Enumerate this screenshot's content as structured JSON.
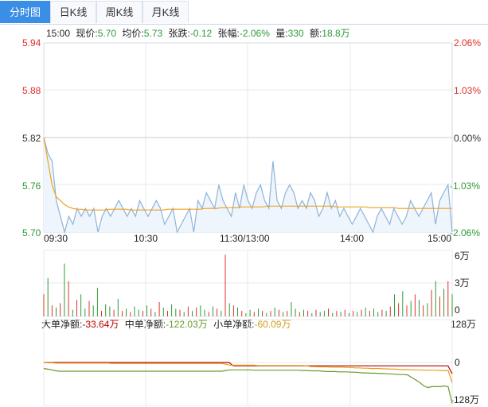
{
  "tabs": [
    {
      "label": "分时图",
      "active": true
    },
    {
      "label": "日K线",
      "active": false
    },
    {
      "label": "周K线",
      "active": false
    },
    {
      "label": "月K线",
      "active": false
    }
  ],
  "info": {
    "time": "15:00",
    "price_label": "现价:",
    "price": "5.70",
    "avg_label": "均价:",
    "avg": "5.73",
    "chg_label": "张跌:",
    "chg": "-0.12",
    "pct_label": "张幅:",
    "pct": "-2.06%",
    "vol_label": "量:",
    "vol": "330",
    "amt_label": "额:",
    "amt": "18.8万"
  },
  "flow": {
    "big_label": "大单净额:",
    "big": "-33.64万",
    "mid_label": "中单净额:",
    "mid": "-122.03万",
    "small_label": "小单净额:",
    "small": "-60.09万"
  },
  "colors": {
    "up": "#e0302c",
    "down": "#2e9a36",
    "price": "#8fb4d9",
    "avg": "#f0a020",
    "big": "#c00000",
    "mid": "#d2a01e",
    "small": "#6a9a2a"
  },
  "chart_data": [
    {
      "type": "line",
      "price_ticks": [
        "5.94",
        "5.88",
        "5.82",
        "5.76",
        "5.70"
      ],
      "pct_ticks": [
        "2.06%",
        "1.03%",
        "0.00%",
        "-1.03%",
        "-2.06%"
      ],
      "time_ticks": [
        "09:30",
        "10:30",
        "11:30/13:00",
        "14:00",
        "15:00"
      ],
      "ylim": [
        5.7,
        5.94
      ],
      "prev_close": 5.82,
      "series": [
        {
          "values": [
            5.82,
            5.8,
            5.79,
            5.74,
            5.72,
            5.7,
            5.72,
            5.71,
            5.73,
            5.72,
            5.73,
            5.72,
            5.73,
            5.7,
            5.72,
            5.73,
            5.72,
            5.73,
            5.74,
            5.73,
            5.72,
            5.73,
            5.72,
            5.74,
            5.73,
            5.72,
            5.73,
            5.74,
            5.73,
            5.71,
            5.72,
            5.73,
            5.7,
            5.71,
            5.72,
            5.73,
            5.7,
            5.74,
            5.73,
            5.75,
            5.74,
            5.73,
            5.76,
            5.74,
            5.73,
            5.72,
            5.75,
            5.73,
            5.76,
            5.74,
            5.73,
            5.75,
            5.76,
            5.74,
            5.73,
            5.79,
            5.74,
            5.73,
            5.75,
            5.76,
            5.75,
            5.73,
            5.74,
            5.73,
            5.75,
            5.74,
            5.72,
            5.73,
            5.75,
            5.73,
            5.74,
            5.72,
            5.73,
            5.72,
            5.71,
            5.72,
            5.73,
            5.72,
            5.71,
            5.7,
            5.72,
            5.73,
            5.72,
            5.71,
            5.73,
            5.72,
            5.71,
            5.72,
            5.74,
            5.73,
            5.72,
            5.73,
            5.74,
            5.75,
            5.71,
            5.74,
            5.75,
            5.76,
            5.7
          ]
        },
        {
          "values": [
            5.82,
            5.79,
            5.76,
            5.745,
            5.74,
            5.735,
            5.732,
            5.73,
            5.729,
            5.729,
            5.728,
            5.728,
            5.728,
            5.728,
            5.728,
            5.728,
            5.729,
            5.729,
            5.729,
            5.729,
            5.729,
            5.728,
            5.728,
            5.728,
            5.728,
            5.728,
            5.728,
            5.728,
            5.728,
            5.728,
            5.729,
            5.729,
            5.729,
            5.729,
            5.729,
            5.729,
            5.729,
            5.729,
            5.729,
            5.73,
            5.73,
            5.73,
            5.73,
            5.731,
            5.731,
            5.731,
            5.731,
            5.731,
            5.732,
            5.732,
            5.732,
            5.732,
            5.732,
            5.732,
            5.733,
            5.733,
            5.733,
            5.733,
            5.733,
            5.733,
            5.733,
            5.733,
            5.733,
            5.733,
            5.733,
            5.733,
            5.733,
            5.733,
            5.733,
            5.733,
            5.733,
            5.732,
            5.732,
            5.732,
            5.732,
            5.732,
            5.732,
            5.732,
            5.732,
            5.731,
            5.731,
            5.731,
            5.731,
            5.731,
            5.731,
            5.731,
            5.73,
            5.73,
            5.73,
            5.73,
            5.73,
            5.73,
            5.73,
            5.73,
            5.73,
            5.73,
            5.73,
            5.73,
            5.73,
            5.73
          ]
        }
      ]
    },
    {
      "type": "bar",
      "y_ticks": [
        "6万",
        "3万",
        "0"
      ],
      "ylim": [
        0,
        6
      ],
      "values": [
        2.0,
        3.5,
        1.0,
        0.8,
        1.2,
        4.8,
        3.2,
        0.6,
        1.5,
        2.0,
        0.7,
        1.4,
        1.0,
        2.6,
        0.5,
        1.1,
        0.9,
        0.6,
        1.6,
        0.5,
        0.7,
        0.4,
        0.9,
        0.6,
        0.5,
        1.0,
        0.7,
        0.4,
        1.3,
        0.8,
        0.5,
        1.1,
        0.7,
        0.6,
        0.4,
        0.9,
        0.5,
        0.8,
        1.0,
        0.6,
        0.4,
        0.9,
        0.7,
        0.5,
        5.6,
        1.2,
        1.0,
        0.8,
        0.5,
        0.3,
        0.6,
        0.4,
        0.7,
        0.5,
        0.3,
        0.5,
        0.8,
        0.6,
        0.4,
        0.5,
        1.3,
        0.7,
        0.4,
        0.6,
        0.5,
        0.3,
        0.6,
        0.4,
        0.5,
        0.7,
        0.3,
        0.5,
        0.4,
        0.6,
        0.3,
        0.5,
        0.4,
        0.6,
        0.8,
        0.5,
        0.7,
        0.4,
        0.6,
        0.5,
        0.9,
        2.0,
        1.2,
        2.3,
        1.0,
        1.4,
        2.0,
        1.5,
        1.0,
        1.2,
        2.4,
        3.2,
        1.8,
        2.5,
        3.2,
        2.0
      ],
      "dirs": [
        "u",
        "d",
        "u",
        "d",
        "u",
        "d",
        "u",
        "d",
        "u",
        "d",
        "d",
        "u",
        "d",
        "d",
        "u",
        "d",
        "d",
        "u",
        "d",
        "u",
        "d",
        "u",
        "d",
        "d",
        "u",
        "d",
        "u",
        "d",
        "u",
        "d",
        "u",
        "d",
        "d",
        "u",
        "d",
        "u",
        "d",
        "u",
        "d",
        "d",
        "u",
        "d",
        "u",
        "d",
        "u",
        "d",
        "u",
        "d",
        "u",
        "d",
        "d",
        "u",
        "d",
        "u",
        "d",
        "u",
        "d",
        "u",
        "d",
        "u",
        "d",
        "d",
        "u",
        "d",
        "u",
        "d",
        "u",
        "d",
        "d",
        "u",
        "d",
        "u",
        "d",
        "u",
        "d",
        "u",
        "d",
        "u",
        "d",
        "u",
        "d",
        "d",
        "u",
        "d",
        "u",
        "d",
        "u",
        "d",
        "u",
        "d",
        "u",
        "d",
        "u",
        "d",
        "u",
        "d",
        "u",
        "d",
        "u",
        "d"
      ]
    },
    {
      "type": "line",
      "y_ticks": [
        "128万",
        "0",
        "-128万"
      ],
      "ylim": [
        -128,
        128
      ],
      "series": [
        {
          "values": [
            0,
            0,
            0,
            0,
            0,
            0,
            0,
            0,
            0,
            0,
            0,
            0,
            0,
            0,
            0,
            0,
            0,
            0,
            0,
            0,
            0,
            0,
            0,
            0,
            0,
            0,
            0,
            0,
            0,
            0,
            0,
            0,
            0,
            0,
            0,
            0,
            0,
            0,
            0,
            0,
            0,
            0,
            0,
            0,
            0,
            -10,
            -10,
            -10,
            -10,
            -10,
            -10,
            -10,
            -10,
            -10,
            -10,
            -10,
            -10,
            -10,
            -10,
            -10,
            -10,
            -10,
            -10,
            -10,
            -10,
            -10,
            -10,
            -10,
            -10,
            -10,
            -10,
            -10,
            -10,
            -10,
            -10,
            -10,
            -10,
            -10,
            -10,
            -10,
            -10,
            -10,
            -10,
            -10,
            -10,
            -10,
            -10,
            -10,
            -10,
            -10,
            -10,
            -10,
            -10,
            -10,
            -10,
            -10,
            -10,
            -33.64
          ]
        },
        {
          "values": [
            0,
            -1,
            -1,
            -2,
            -2,
            -2,
            -2,
            -2,
            -2,
            -2,
            -2,
            -2,
            -2,
            -2,
            -2,
            -2,
            -2,
            -3,
            -3,
            -3,
            -3,
            -3,
            -3,
            -3,
            -3,
            -3,
            -3,
            -3,
            -3,
            -3,
            -3,
            -3,
            -3,
            -3,
            -3,
            -3,
            -3,
            -3,
            -3,
            -3,
            -3,
            -3,
            -3,
            -3,
            -3,
            -5,
            -8,
            -8,
            -8,
            -8,
            -8,
            -8,
            -8,
            -9,
            -9,
            -9,
            -9,
            -9,
            -9,
            -9,
            -9,
            -9,
            -9,
            -9,
            -9,
            -10,
            -12,
            -12,
            -13,
            -13,
            -13,
            -14,
            -14,
            -14,
            -14,
            -15,
            -15,
            -16,
            -16,
            -17,
            -17,
            -18,
            -18,
            -18,
            -19,
            -19,
            -20,
            -20,
            -21,
            -21,
            -21,
            -22,
            -22,
            -22,
            -23,
            -23,
            -23,
            -23,
            -24,
            -24,
            -24,
            -60.09
          ]
        },
        {
          "values": [
            -18,
            -20,
            -22,
            -25,
            -26,
            -26,
            -26,
            -26,
            -26,
            -26,
            -26,
            -26,
            -26,
            -26,
            -26,
            -26,
            -26,
            -26,
            -26,
            -26,
            -26,
            -26,
            -26,
            -26,
            -26,
            -26,
            -26,
            -26,
            -26,
            -26,
            -26,
            -26,
            -26,
            -26,
            -26,
            -26,
            -26,
            -26,
            -26,
            -26,
            -26,
            -26,
            -26,
            -26,
            -26,
            -24,
            -22,
            -22,
            -22,
            -22,
            -22,
            -22,
            -23,
            -23,
            -23,
            -23,
            -23,
            -23,
            -23,
            -23,
            -23,
            -23,
            -23,
            -23,
            -24,
            -24,
            -25,
            -25,
            -25,
            -26,
            -27,
            -27,
            -27,
            -28,
            -28,
            -28,
            -29,
            -29,
            -30,
            -31,
            -31,
            -32,
            -32,
            -33,
            -33,
            -34,
            -34,
            -35,
            -36,
            -36,
            -37,
            -45,
            -52,
            -60,
            -70,
            -75,
            -72,
            -72,
            -72,
            -70,
            -72,
            -122.03
          ]
        }
      ]
    }
  ]
}
